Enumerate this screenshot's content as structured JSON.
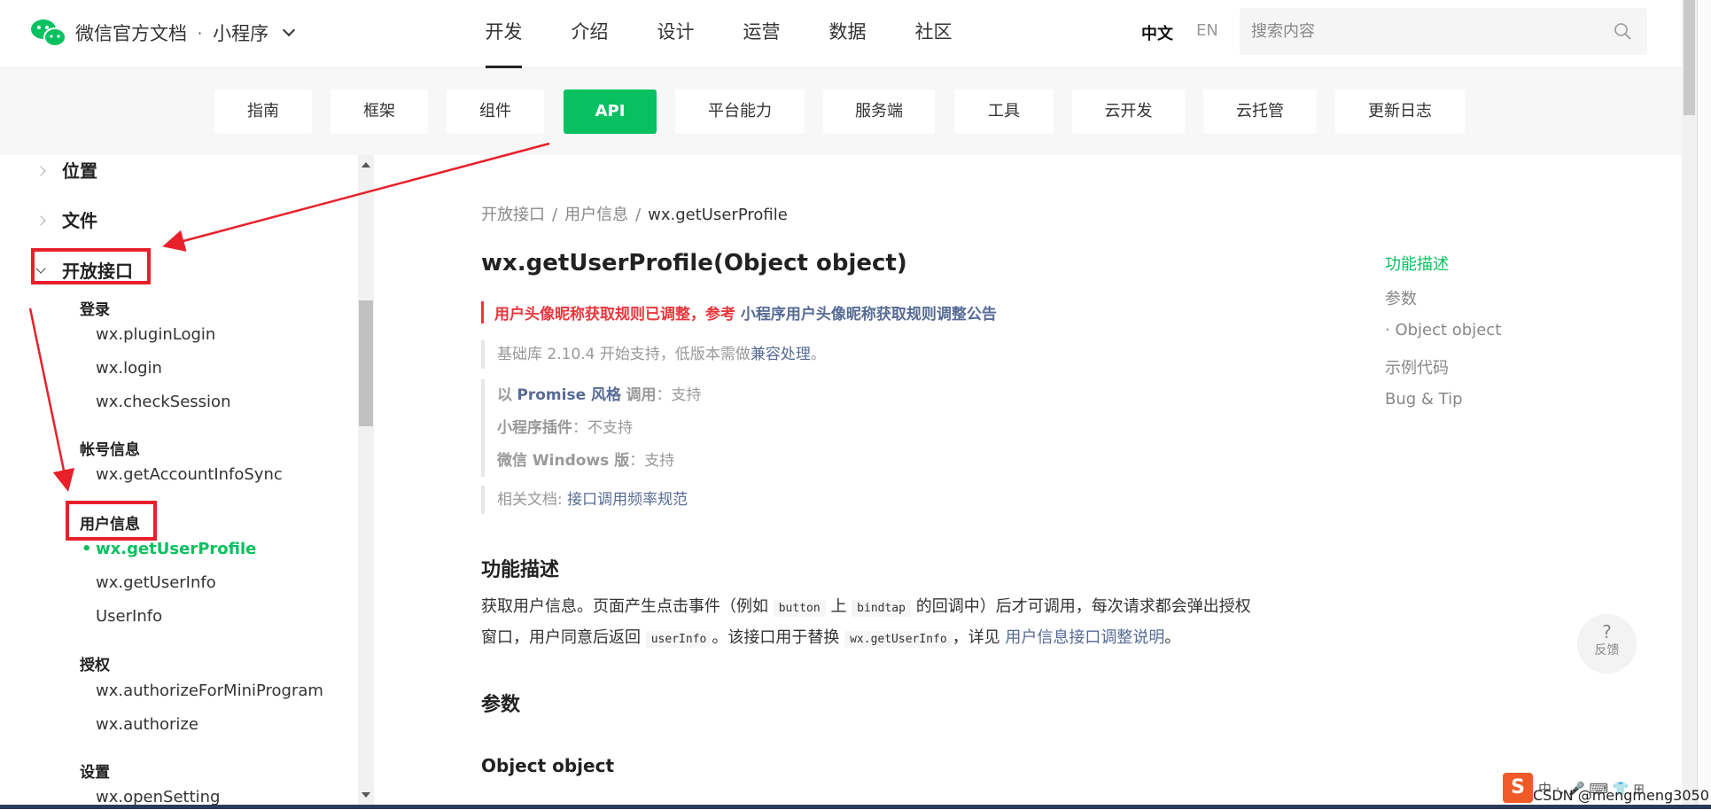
{
  "header": {
    "brand": "微信官方文档",
    "separator": "·",
    "product": "小程序",
    "nav": [
      "开发",
      "介绍",
      "设计",
      "运营",
      "数据",
      "社区"
    ],
    "nav_active": "开发",
    "lang_zh": "中文",
    "lang_en": "EN",
    "search_placeholder": "搜索内容"
  },
  "subnav": {
    "tabs": [
      "指南",
      "框架",
      "组件",
      "API",
      "平台能力",
      "服务端",
      "工具",
      "云开发",
      "云托管",
      "更新日志"
    ],
    "active": "API"
  },
  "sidebar": {
    "top_items": [
      "位置",
      "文件",
      "开放接口"
    ],
    "groups": [
      {
        "title": "登录",
        "items": [
          "wx.pluginLogin",
          "wx.login",
          "wx.checkSession"
        ]
      },
      {
        "title": "帐号信息",
        "items": [
          "wx.getAccountInfoSync"
        ]
      },
      {
        "title": "用户信息",
        "items": [
          "wx.getUserProfile",
          "wx.getUserInfo",
          "UserInfo"
        ]
      },
      {
        "title": "授权",
        "items": [
          "wx.authorizeForMiniProgram",
          "wx.authorize"
        ]
      },
      {
        "title": "设置",
        "items": [
          "wx.openSetting"
        ]
      }
    ],
    "active_item": "wx.getUserProfile",
    "bullet": "•"
  },
  "breadcrumb": [
    "开放接口",
    "用户信息",
    "wx.getUserProfile"
  ],
  "breadcrumb_sep": "/",
  "page": {
    "title": "wx.getUserProfile(Object object)",
    "notice_text": "用户头像昵称获取规则已调整，参考",
    "notice_link": "小程序用户头像昵称获取规则调整公告",
    "support_text": "基础库 2.10.4 开始支持，低版本需做",
    "support_link": "兼容处理",
    "support_end": "。",
    "promise_prefix": "以",
    "promise_link": "Promise 风格",
    "promise_label": "调用",
    "promise_value": "：支持",
    "plugin_label": "小程序插件",
    "plugin_value": "：不支持",
    "windows_label": "微信 Windows 版",
    "windows_value": "：支持",
    "related_label": "相关文档:",
    "related_link": "接口调用频率规范",
    "section_desc": "功能描述",
    "desc_1": "获取用户信息。页面产生点击事件（例如",
    "desc_code1": "button",
    "desc_2": "上",
    "desc_code2": "bindtap",
    "desc_3": "的回调中）后才可调用，每次请求都会弹出授权窗口，用户同意后返回",
    "desc_code3": "userInfo",
    "desc_4": "。该接口用于替换",
    "desc_code4": "wx.getUserInfo",
    "desc_5": "，详见",
    "desc_link": "用户信息接口调整说明",
    "desc_6": "。",
    "section_params": "参数",
    "section_object": "Object object"
  },
  "toc": [
    "功能描述",
    "参数",
    "· Object object",
    "示例代码",
    "Bug & Tip"
  ],
  "toc_active": "功能描述",
  "feedback": {
    "icon": "?",
    "label": "反馈"
  },
  "ime": {
    "logo": "S",
    "text": "中 ·, 🎤 ⌨ 👕 ⊞",
    "watermark": "CSDN @mengmeng3050"
  },
  "colors": {
    "accent": "#07c160",
    "link": "#576b95",
    "notice": "#e8383d",
    "annotation": "#e8202a"
  }
}
